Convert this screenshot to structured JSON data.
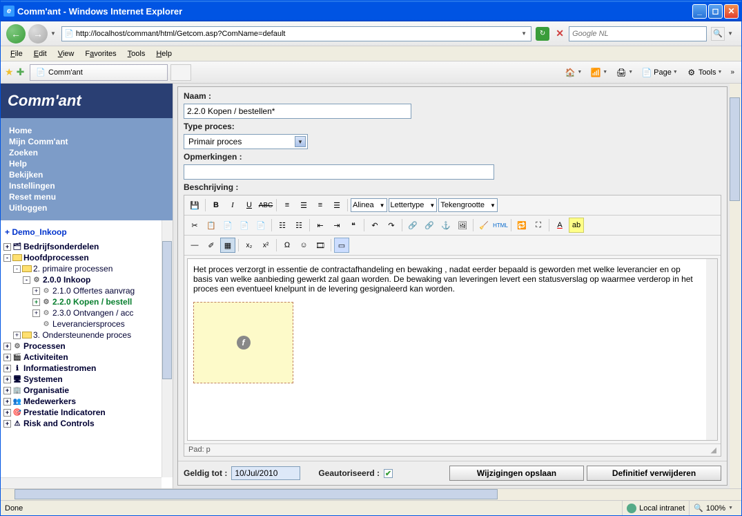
{
  "window": {
    "title": "Comm'ant - Windows Internet Explorer"
  },
  "nav": {
    "url": "http://localhost/commant/html/Getcom.asp?ComName=default",
    "search_placeholder": "Google NL"
  },
  "menu": {
    "file": "File",
    "edit": "Edit",
    "view": "View",
    "favorites": "Favorites",
    "tools": "Tools",
    "help": "Help"
  },
  "tab": {
    "title": "Comm'ant"
  },
  "toolbar": {
    "page": "Page",
    "tools": "Tools"
  },
  "sidebar": {
    "logo": "Comm'ant",
    "links": [
      "Home",
      "Mijn Comm'ant",
      "Zoeken",
      "Help",
      "Bekijken",
      "Instellingen",
      "Reset menu",
      "Uitloggen"
    ],
    "tree_header": "+ Demo_Inkoop",
    "tree": [
      {
        "toggle": "+",
        "icon": "folder-group",
        "text": "Bedrijfsonderdelen",
        "ind": 0,
        "bold": true
      },
      {
        "toggle": "-",
        "icon": "folder",
        "text": "Hoofdprocessen",
        "ind": 0,
        "bold": true
      },
      {
        "toggle": "-",
        "icon": "folder",
        "text": "2. primaire processen",
        "ind": 1
      },
      {
        "toggle": "-",
        "icon": "gear",
        "text": "2.0.0 Inkoop",
        "ind": 2,
        "bold": true
      },
      {
        "toggle": "+",
        "icon": "gear",
        "text": "2.1.0 Offertes aanvrag",
        "ind": 3
      },
      {
        "toggle": "+",
        "icon": "gear",
        "text": "2.2.0 Kopen / bestell",
        "ind": 3,
        "selected": true
      },
      {
        "toggle": "+",
        "icon": "gear",
        "text": "2.3.0 Ontvangen / acc",
        "ind": 3
      },
      {
        "toggle": "",
        "icon": "gear",
        "text": "Leveranciersproces",
        "ind": 3
      },
      {
        "toggle": "+",
        "icon": "folder",
        "text": "3. Ondersteunende proces",
        "ind": 1
      },
      {
        "toggle": "+",
        "icon": "gear",
        "text": "Processen",
        "ind": 0,
        "bold": true
      },
      {
        "toggle": "+",
        "icon": "film",
        "text": "Activiteiten",
        "ind": 0,
        "bold": true
      },
      {
        "toggle": "+",
        "icon": "info",
        "text": "Informatiestromen",
        "ind": 0,
        "bold": true
      },
      {
        "toggle": "+",
        "icon": "system",
        "text": "Systemen",
        "ind": 0,
        "bold": true
      },
      {
        "toggle": "+",
        "icon": "org",
        "text": "Organisatie",
        "ind": 0,
        "bold": true
      },
      {
        "toggle": "+",
        "icon": "people",
        "text": "Medewerkers",
        "ind": 0,
        "bold": true
      },
      {
        "toggle": "+",
        "icon": "target",
        "text": "Prestatie Indicatoren",
        "ind": 0,
        "bold": true
      },
      {
        "toggle": "+",
        "icon": "warn",
        "text": "Risk and Controls",
        "ind": 0,
        "bold": true
      }
    ]
  },
  "form": {
    "naam_label": "Naam :",
    "naam_value": "2.2.0 Kopen / bestellen*",
    "type_label": "Type proces:",
    "type_value": "Primair proces",
    "opm_label": "Opmerkingen :",
    "opm_value": "",
    "desc_label": "Beschrijving :",
    "desc_text": "Het proces verzorgt in essentie de contractafhandeling en bewaking , nadat eerder bepaald is geworden met welke leverancier en op basis van welke aanbieding gewerkt zal gaan worden. De bewaking van leveringen levert een statusverslag op waarmee verderop in het proces een eventueel knelpunt in de levering gesignaleerd kan worden.",
    "path_label": "Pad: p",
    "valid_label": "Geldig tot :",
    "valid_value": "10/Jul/2010",
    "auth_label": "Geautoriseerd :",
    "save_btn": "Wijzigingen opslaan",
    "delete_btn": "Definitief verwijderen"
  },
  "editor": {
    "style_sel": "Alinea",
    "font_sel": "Lettertype",
    "size_sel": "Tekengrootte"
  },
  "status": {
    "done": "Done",
    "zone": "Local intranet",
    "zoom": "100%"
  }
}
